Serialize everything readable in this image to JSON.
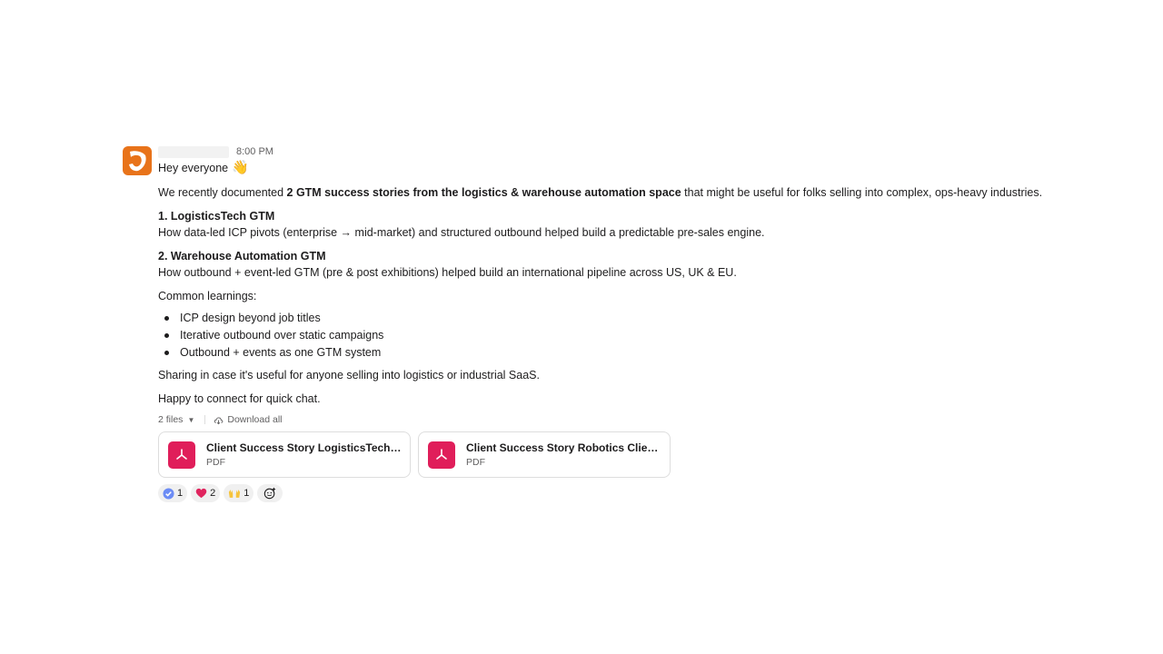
{
  "message": {
    "timestamp": "8:00 PM",
    "greeting": "Hey everyone",
    "greeting_emoji": "👋",
    "intro_before": "We recently documented ",
    "intro_bold": "2 GTM success stories from the logistics & warehouse automation space",
    "intro_after": " that might be useful for folks selling into complex, ops-heavy industries.",
    "story1_title": "1. LogisticsTech GTM",
    "story1_desc": "How data-led ICP pivots (enterprise → mid-market) and structured outbound helped build a predictable pre-sales engine.",
    "story2_title": "2.  Warehouse Automation GTM",
    "story2_desc": "How outbound + event-led GTM (pre & post exhibitions) helped build an international pipeline across US, UK & EU.",
    "learnings_label": "Common learnings:",
    "learnings": [
      "ICP design beyond job titles",
      "Iterative outbound over static campaigns",
      "Outbound + events as one GTM system"
    ],
    "closing1": "Sharing in case it's useful for anyone selling into logistics or industrial SaaS.",
    "closing2": "Happy to connect for quick chat."
  },
  "files": {
    "count_label": "2 files",
    "download_all": "Download all",
    "items": [
      {
        "title": "Client Success Story LogisticsTech ...",
        "type": "PDF"
      },
      {
        "title": "Client Success Story Robotics Clien...",
        "type": "PDF"
      }
    ]
  },
  "reactions": [
    {
      "icon": "check-icon",
      "count": "1"
    },
    {
      "icon": "heart-icon",
      "count": "2"
    },
    {
      "icon": "raised-hands-icon",
      "count": "1"
    }
  ],
  "colors": {
    "pdf": "#e01e5a",
    "avatar": "#e8731a",
    "text": "#1d1c1d",
    "muted": "#616061"
  }
}
